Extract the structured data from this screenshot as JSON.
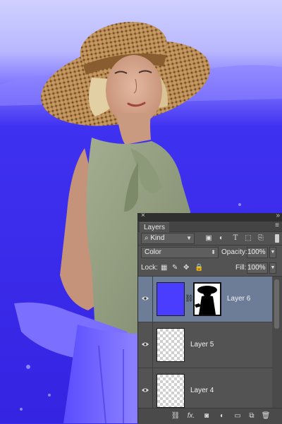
{
  "panel": {
    "close_glyph": "×",
    "collapse_glyph": "»",
    "tab_label": "Layers",
    "menu_glyph": "≡",
    "filter": {
      "search_glyph": "⌕",
      "kind_value": "Kind",
      "icons": [
        "image-filter-icon",
        "adjustment-filter-icon",
        "type-filter-icon",
        "shape-filter-icon",
        "smart-object-filter-icon"
      ]
    },
    "blend_mode": "Color",
    "opacity_label": "Opacity:",
    "opacity_value": "100%",
    "lock_label": "Lock:",
    "fill_label": "Fill:",
    "fill_value": "100%",
    "layers": [
      {
        "name": "Layer 6",
        "selected": true,
        "thumb": "blue-fill",
        "mask": "silhouette",
        "visible": true
      },
      {
        "name": "Layer 5",
        "selected": false,
        "thumb": "transparent",
        "visible": true
      },
      {
        "name": "Layer 4",
        "selected": false,
        "thumb": "transparent",
        "visible": true
      }
    ],
    "bottom_icons": [
      "link-layers-icon",
      "fx-icon",
      "add-mask-icon",
      "adjustment-layer-icon",
      "new-group-icon",
      "new-layer-icon",
      "delete-layer-icon"
    ],
    "fx_text": "fx.",
    "colors": {
      "selected_row": "#6d7d97",
      "layer6_fill": "#4a3dff",
      "panel_bg": "#535353"
    }
  }
}
